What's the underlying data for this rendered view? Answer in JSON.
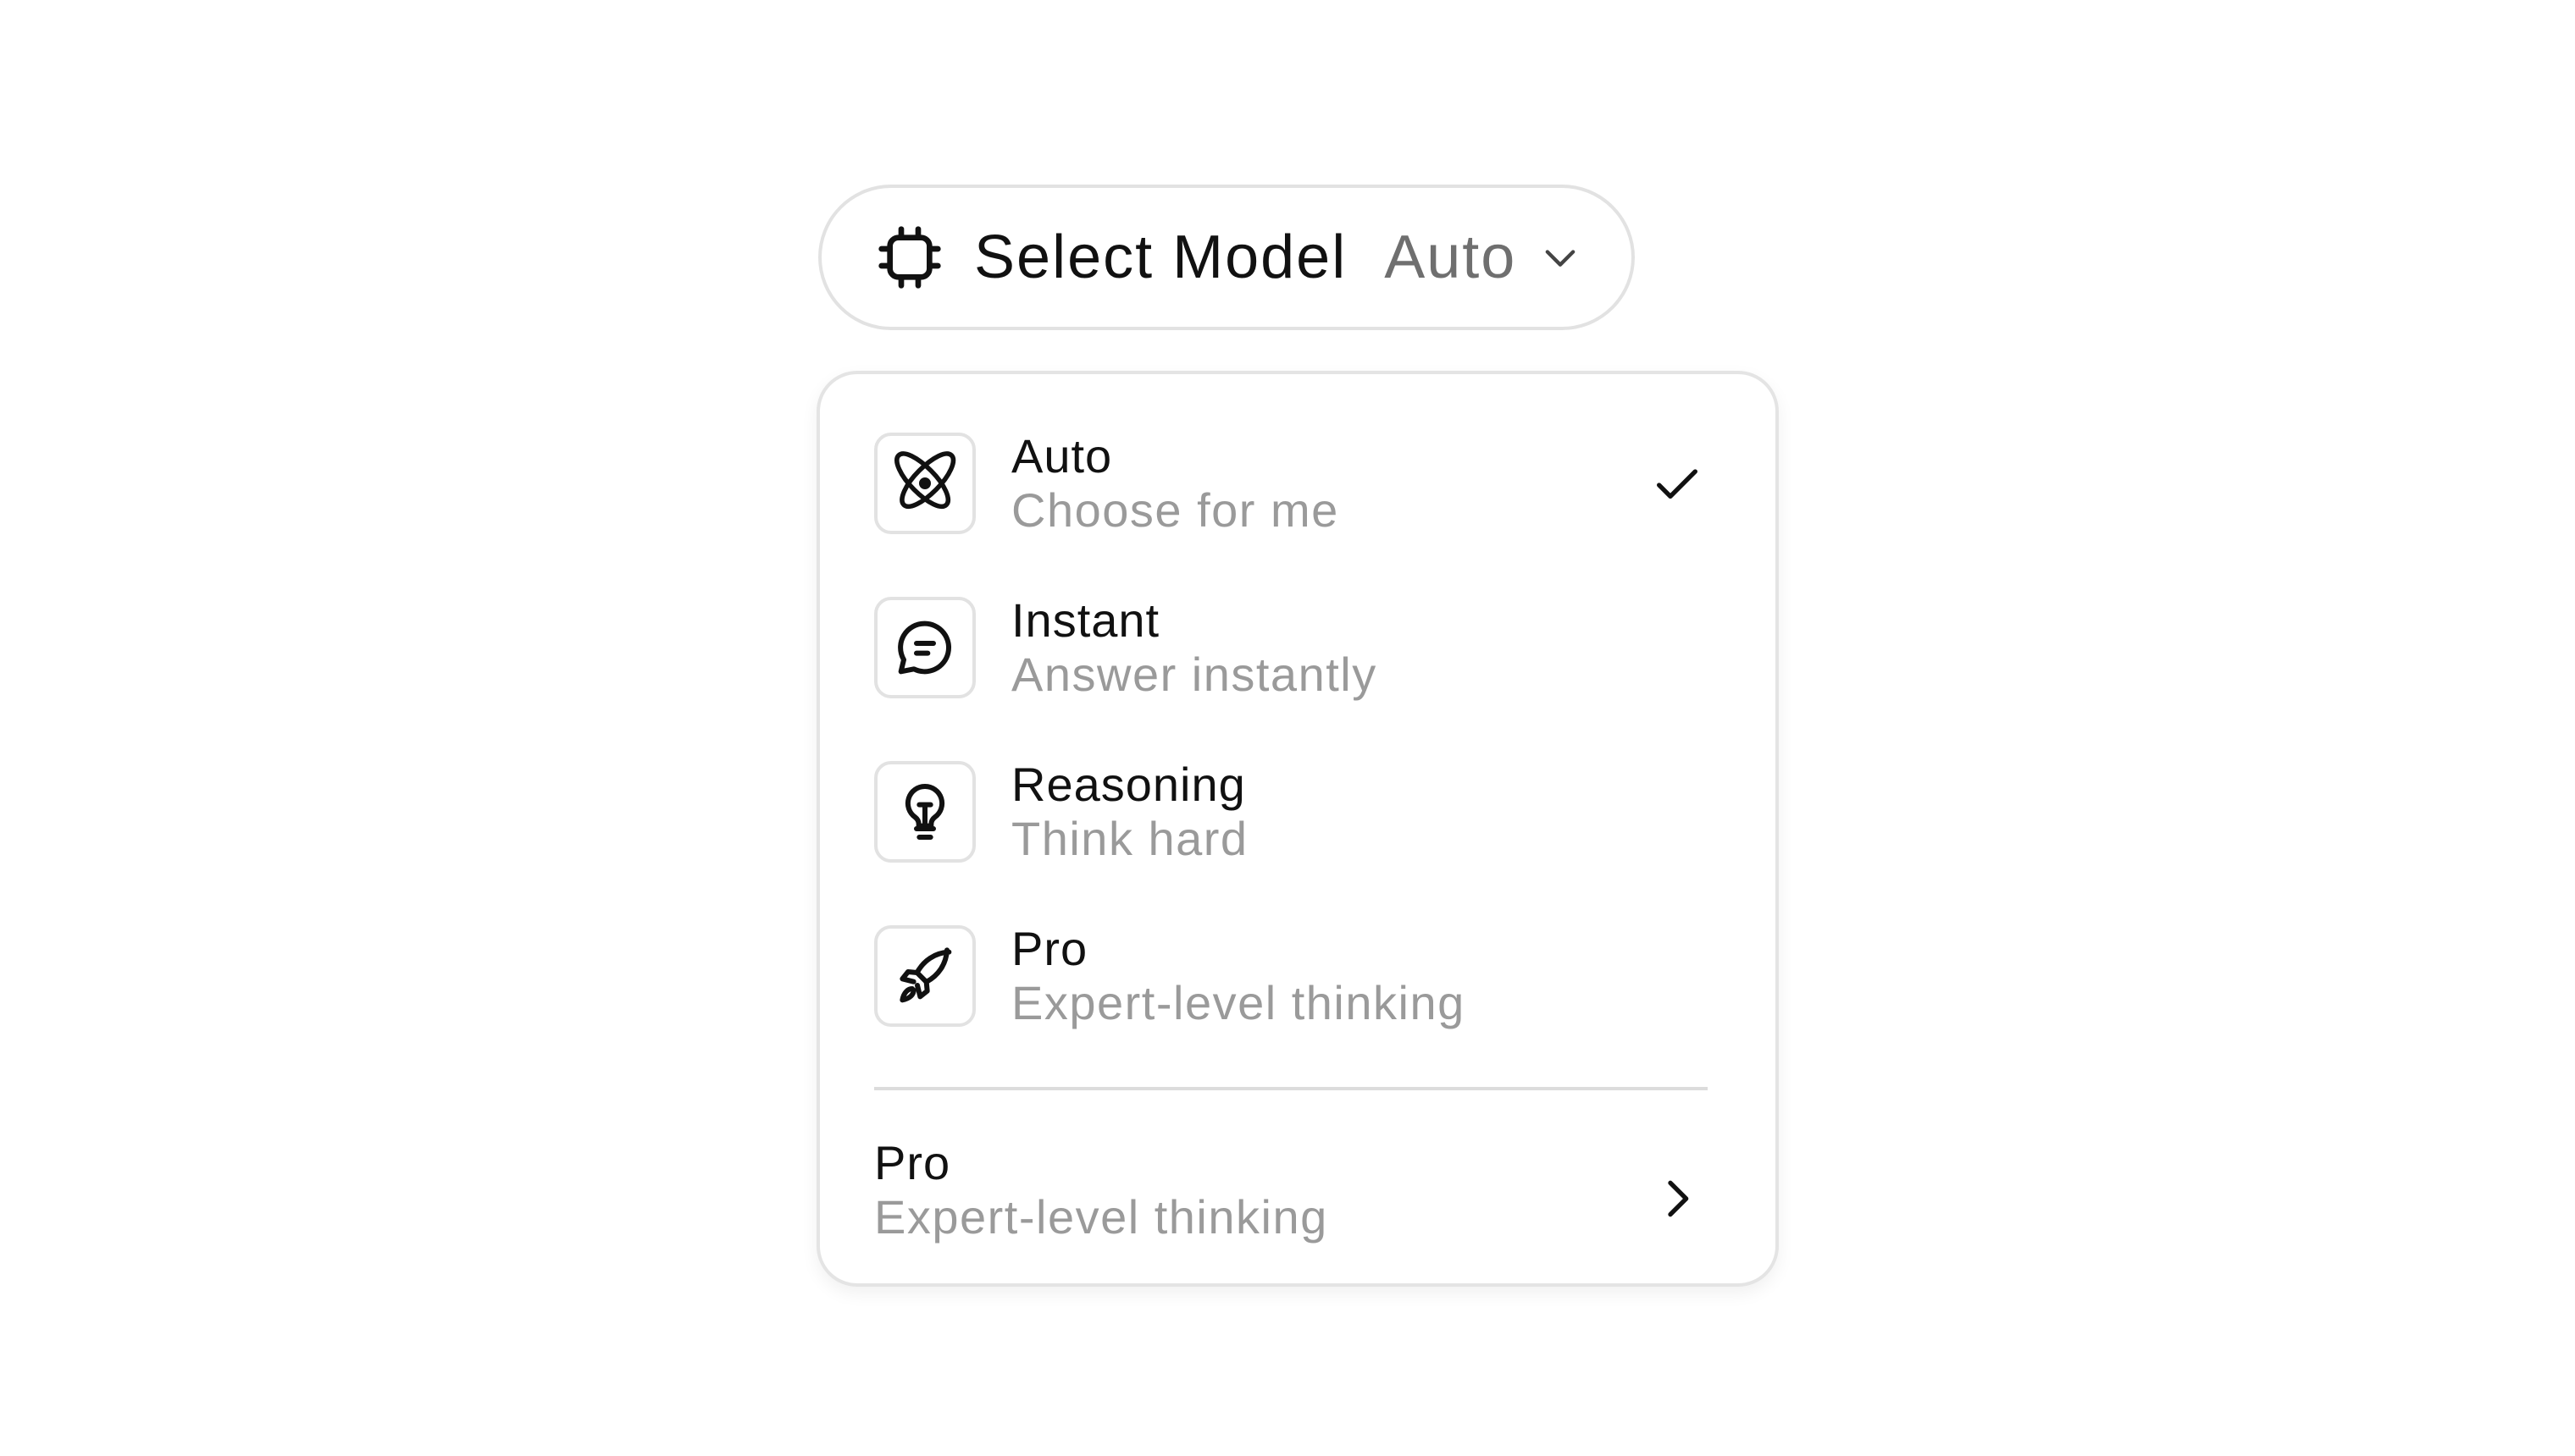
{
  "trigger": {
    "label": "Select Model",
    "value": "Auto",
    "icon": "chip-icon",
    "caret_icon": "chevron-down-icon"
  },
  "options": [
    {
      "title": "Auto",
      "subtitle": "Choose for me",
      "icon": "atom-icon",
      "selected": true
    },
    {
      "title": "Instant",
      "subtitle": "Answer instantly",
      "icon": "chat-bubble-icon",
      "selected": false
    },
    {
      "title": "Reasoning",
      "subtitle": "Think hard",
      "icon": "lightbulb-icon",
      "selected": false
    },
    {
      "title": "Pro",
      "subtitle": "Expert-level thinking",
      "icon": "rocket-icon",
      "selected": false
    }
  ],
  "more": {
    "title": "Pro",
    "subtitle": "Expert-level thinking",
    "icon": "chevron-right-icon"
  },
  "colors": {
    "text_primary": "#111111",
    "text_secondary": "#9a9a9a",
    "border": "#e2e2e2",
    "background": "#ffffff"
  }
}
